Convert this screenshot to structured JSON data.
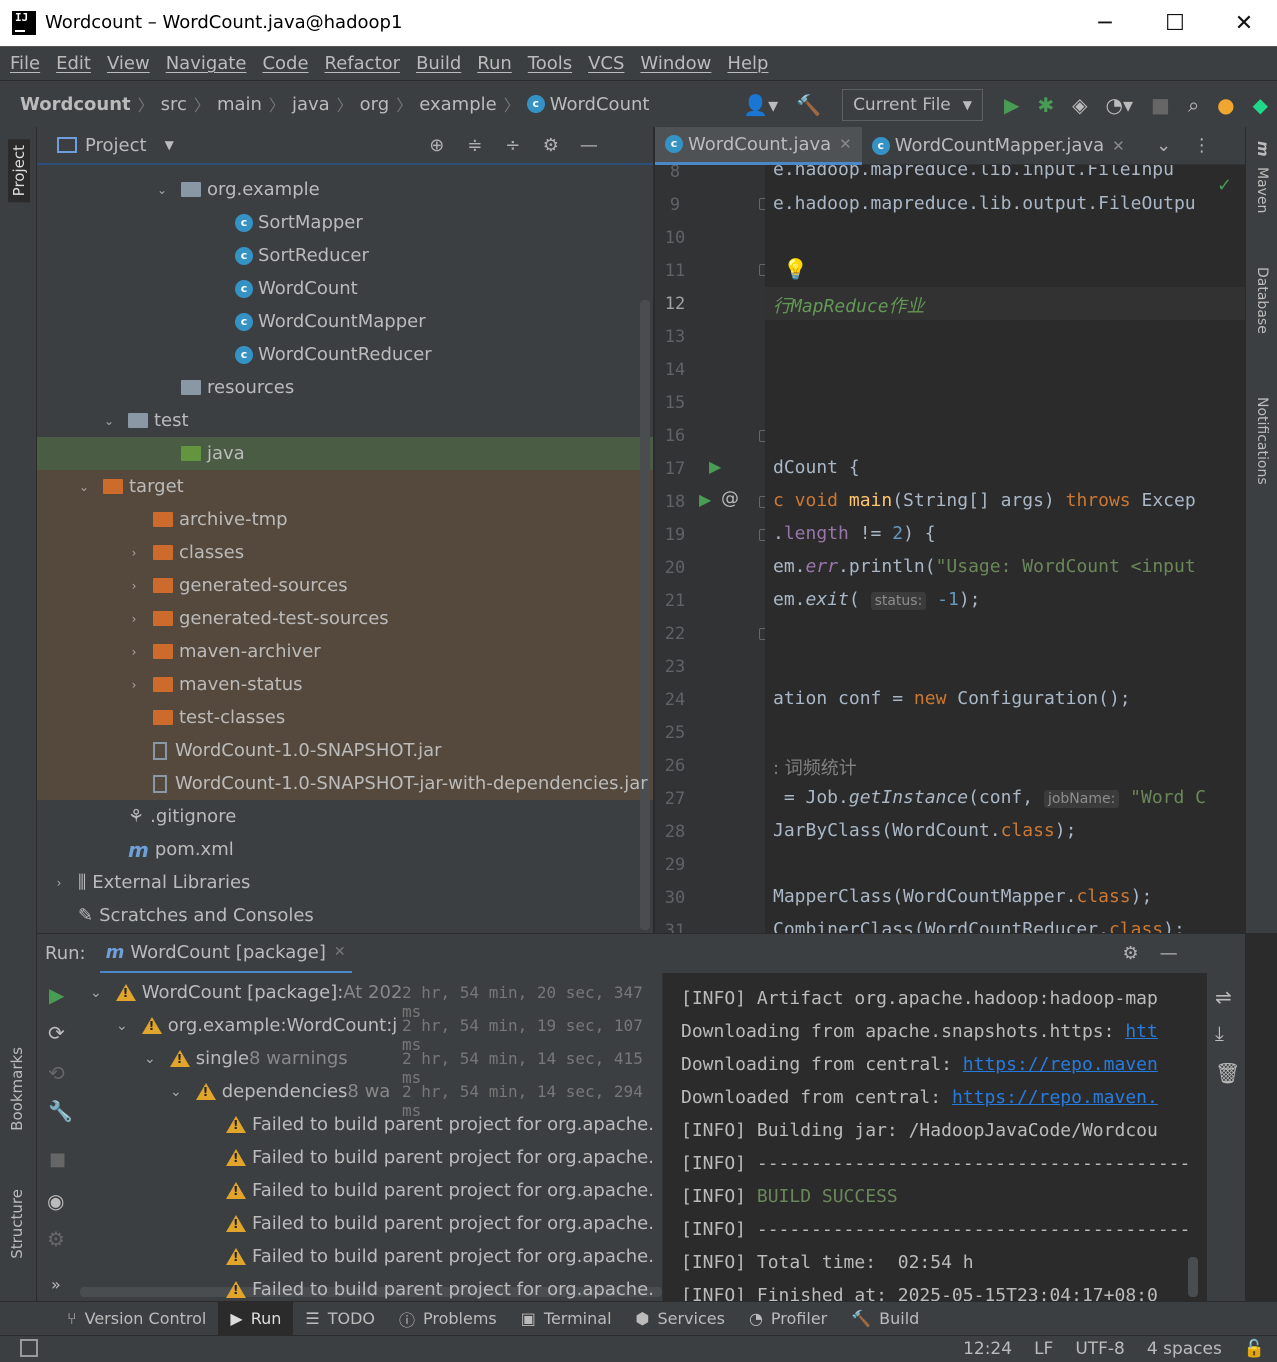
{
  "window": {
    "title": "Wordcount – WordCount.java@hadoop1",
    "logo": "IJ"
  },
  "menu": [
    "File",
    "Edit",
    "View",
    "Navigate",
    "Code",
    "Refactor",
    "Build",
    "Run",
    "Tools",
    "VCS",
    "Window",
    "Help"
  ],
  "breadcrumb": [
    "Wordcount",
    "src",
    "main",
    "java",
    "org",
    "example",
    "WordCount"
  ],
  "run_config": "Current File",
  "project": {
    "header": "Project",
    "items": [
      {
        "label": "org.example",
        "depth": 4,
        "type": "package",
        "arrow": "v"
      },
      {
        "label": "SortMapper",
        "depth": 6,
        "type": "class"
      },
      {
        "label": "SortReducer",
        "depth": 6,
        "type": "class"
      },
      {
        "label": "WordCount",
        "depth": 6,
        "type": "class-run"
      },
      {
        "label": "WordCountMapper",
        "depth": 6,
        "type": "class"
      },
      {
        "label": "WordCountReducer",
        "depth": 6,
        "type": "class"
      },
      {
        "label": "resources",
        "depth": 4,
        "type": "res"
      },
      {
        "label": "test",
        "depth": 2,
        "type": "folder",
        "arrow": "v"
      },
      {
        "label": "java",
        "depth": 4,
        "type": "green",
        "selected": true
      },
      {
        "label": "target",
        "depth": 1,
        "type": "orange",
        "arrow": "v",
        "excluded": true
      },
      {
        "label": "archive-tmp",
        "depth": 3,
        "type": "orange",
        "excluded": true
      },
      {
        "label": "classes",
        "depth": 3,
        "type": "orange",
        "arrow": ">",
        "excluded": true
      },
      {
        "label": "generated-sources",
        "depth": 3,
        "type": "orange",
        "arrow": ">",
        "excluded": true
      },
      {
        "label": "generated-test-sources",
        "depth": 3,
        "type": "orange",
        "arrow": ">",
        "excluded": true
      },
      {
        "label": "maven-archiver",
        "depth": 3,
        "type": "orange",
        "arrow": ">",
        "excluded": true
      },
      {
        "label": "maven-status",
        "depth": 3,
        "type": "orange",
        "arrow": ">",
        "excluded": true
      },
      {
        "label": "test-classes",
        "depth": 3,
        "type": "orange",
        "excluded": true
      },
      {
        "label": "WordCount-1.0-SNAPSHOT.jar",
        "depth": 3,
        "type": "jar",
        "excluded": true
      },
      {
        "label": "WordCount-1.0-SNAPSHOT-jar-with-dependencies.jar",
        "depth": 3,
        "type": "jar",
        "excluded": true
      },
      {
        "label": ".gitignore",
        "depth": 2,
        "type": "git"
      },
      {
        "label": "pom.xml",
        "depth": 2,
        "type": "maven"
      },
      {
        "label": "External Libraries",
        "depth": 0,
        "type": "lib",
        "arrow": ">"
      },
      {
        "label": "Scratches and Consoles",
        "depth": 0,
        "type": "scratch"
      }
    ]
  },
  "editor": {
    "tabs": [
      {
        "label": "WordCount.java",
        "active": true
      },
      {
        "label": "WordCountMapper.java",
        "active": false
      }
    ],
    "line_numbers": [
      "8",
      "9",
      "10",
      "11",
      "12",
      "13",
      "14",
      "15",
      "16",
      "17",
      "18",
      "19",
      "20",
      "21",
      "22",
      "23",
      "24",
      "25",
      "26",
      "27",
      "28",
      "29",
      "30",
      "31"
    ],
    "hint_status": "status:",
    "hint_jobname": "jobName:"
  },
  "run": {
    "label": "Run:",
    "tab": "WordCount [package]",
    "tree": [
      {
        "label": "WordCount [package]:",
        "suffix": " At 202",
        "dur": "2 hr, 54 min, 20 sec, 347 ms",
        "depth": 0
      },
      {
        "label": "org.example:WordCount:j",
        "suffix": "",
        "dur": "2 hr, 54 min, 19 sec, 107 ms",
        "depth": 1
      },
      {
        "label": "single",
        "suffix": "  8 warnings",
        "dur": "2 hr, 54 min, 14 sec, 415 ms",
        "depth": 2
      },
      {
        "label": "dependencies",
        "suffix": "  8 wa",
        "dur": "2 hr, 54 min, 14 sec, 294 ms",
        "depth": 3
      },
      {
        "label": "Failed to build parent project for org.apache.",
        "depth": 4
      },
      {
        "label": "Failed to build parent project for org.apache.",
        "depth": 4
      },
      {
        "label": "Failed to build parent project for org.apache.",
        "depth": 4
      },
      {
        "label": "Failed to build parent project for org.apache.",
        "depth": 4
      },
      {
        "label": "Failed to build parent project for org.apache.",
        "depth": 4
      },
      {
        "label": "Failed to build parent project for org.apache.",
        "depth": 4
      }
    ],
    "console": [
      {
        "prefix": "[INFO] ",
        "text": "Artifact org.apache.hadoop:hadoop-map"
      },
      {
        "prefix": "",
        "text": "Downloading from apache.snapshots.https: ",
        "link": "htt"
      },
      {
        "prefix": "",
        "text": "Downloading from central: ",
        "link": "https://repo.maven"
      },
      {
        "prefix": "",
        "text": "Downloaded from central: ",
        "link": "https://repo.maven."
      },
      {
        "prefix": "[INFO] ",
        "text": "Building jar: /HadoopJavaCode/Wordcou"
      },
      {
        "prefix": "[INFO] ",
        "text": "----------------------------------------"
      },
      {
        "prefix": "[INFO] ",
        "text": "BUILD SUCCESS",
        "ok": true
      },
      {
        "prefix": "[INFO] ",
        "text": "----------------------------------------"
      },
      {
        "prefix": "[INFO] ",
        "text": "Total time:  02:54 h"
      },
      {
        "prefix": "[INFO] ",
        "text": "Finished at: 2025-05-15T23:04:17+08:0"
      }
    ]
  },
  "bottom_tabs": [
    "Version Control",
    "Run",
    "TODO",
    "Problems",
    "Terminal",
    "Services",
    "Profiler",
    "Build"
  ],
  "status": {
    "pos": "12:24",
    "eol": "LF",
    "enc": "UTF-8",
    "indent": "4 spaces"
  },
  "side": {
    "left": [
      "Project",
      "Bookmarks",
      "Structure"
    ],
    "right": [
      "Maven",
      "Database",
      "Notifications"
    ]
  }
}
